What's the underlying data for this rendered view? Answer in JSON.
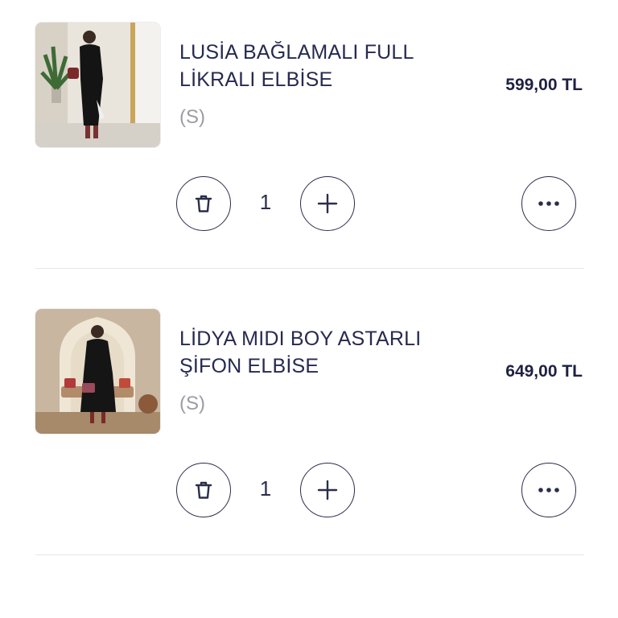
{
  "cart": {
    "items": [
      {
        "name_line1": "LUSİA BAĞLAMALI FULL",
        "name_line2": "LİKRALI ELBİSE",
        "variant": "(S)",
        "price": "599,00 TL",
        "quantity": "1",
        "image_icon": "product-photo-black-dress-icon"
      },
      {
        "name_line1": "LİDYA MIDI BOY ASTARLI",
        "name_line2": "ŞİFON ELBİSE",
        "variant": "(S)",
        "price": "649,00 TL",
        "quantity": "1",
        "image_icon": "product-photo-chiffon-dress-icon"
      }
    ],
    "icons": {
      "delete": "trash-icon",
      "increase": "plus-icon",
      "more": "more-options-icon"
    },
    "colors": {
      "text_primary": "#262a50",
      "text_muted": "#9c9ca6",
      "button_border": "#2b2e4a",
      "divider": "#e6e6ea"
    }
  }
}
